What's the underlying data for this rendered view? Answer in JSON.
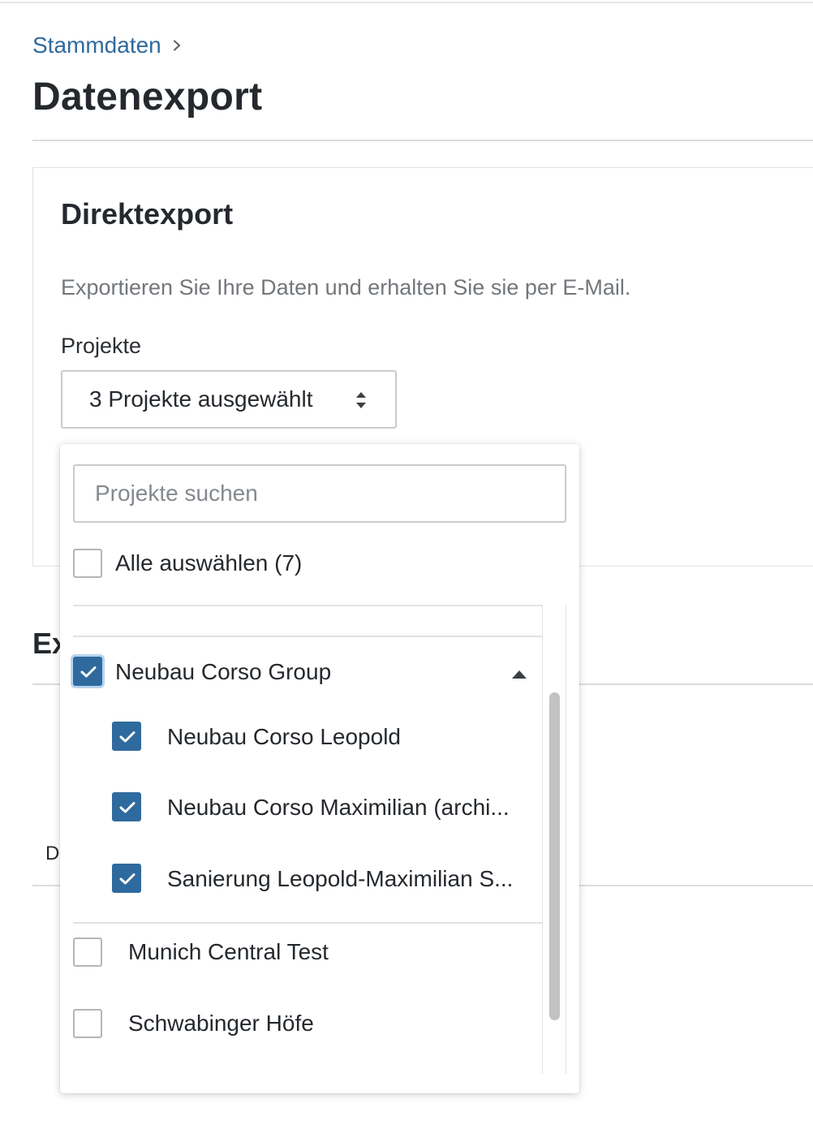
{
  "breadcrumb": {
    "parent_label": "Stammdaten"
  },
  "page": {
    "title": "Datenexport"
  },
  "direct_export": {
    "title": "Direktexport",
    "description": "Exportieren Sie Ihre Daten und erhalten Sie sie per E-Mail.",
    "projects_label": "Projekte",
    "projects_select_value": "3 Projekte ausgewählt"
  },
  "background_section": {
    "heading_partial": "Ex",
    "row_letter": "D"
  },
  "dropdown": {
    "search_placeholder": "Projekte suchen",
    "select_all_label": "Alle auswählen (7)",
    "select_all_checked": false,
    "groups": [
      {
        "label": "Neubau Corso Group",
        "checked": true,
        "expanded": true,
        "children": [
          {
            "label": "Neubau Corso Leopold",
            "checked": true
          },
          {
            "label": "Neubau Corso Maximilian (archi...",
            "checked": true
          },
          {
            "label": "Sanierung Leopold-Maximilian S...",
            "checked": true
          }
        ]
      }
    ],
    "items": [
      {
        "label": "Munich Central Test",
        "checked": false
      },
      {
        "label": "Schwabinger Höfe",
        "checked": false
      }
    ]
  },
  "colors": {
    "accent": "#2f6a9e",
    "link": "#2f6a9e",
    "text": "#25292d",
    "muted_text": "#73777b",
    "border": "#c9cbcd"
  },
  "icons": {
    "breadcrumb_separator": "chevron-right-icon",
    "select_indicator": "sort-arrows-icon",
    "checkmark": "check-icon",
    "group_toggle": "caret-up-icon"
  }
}
